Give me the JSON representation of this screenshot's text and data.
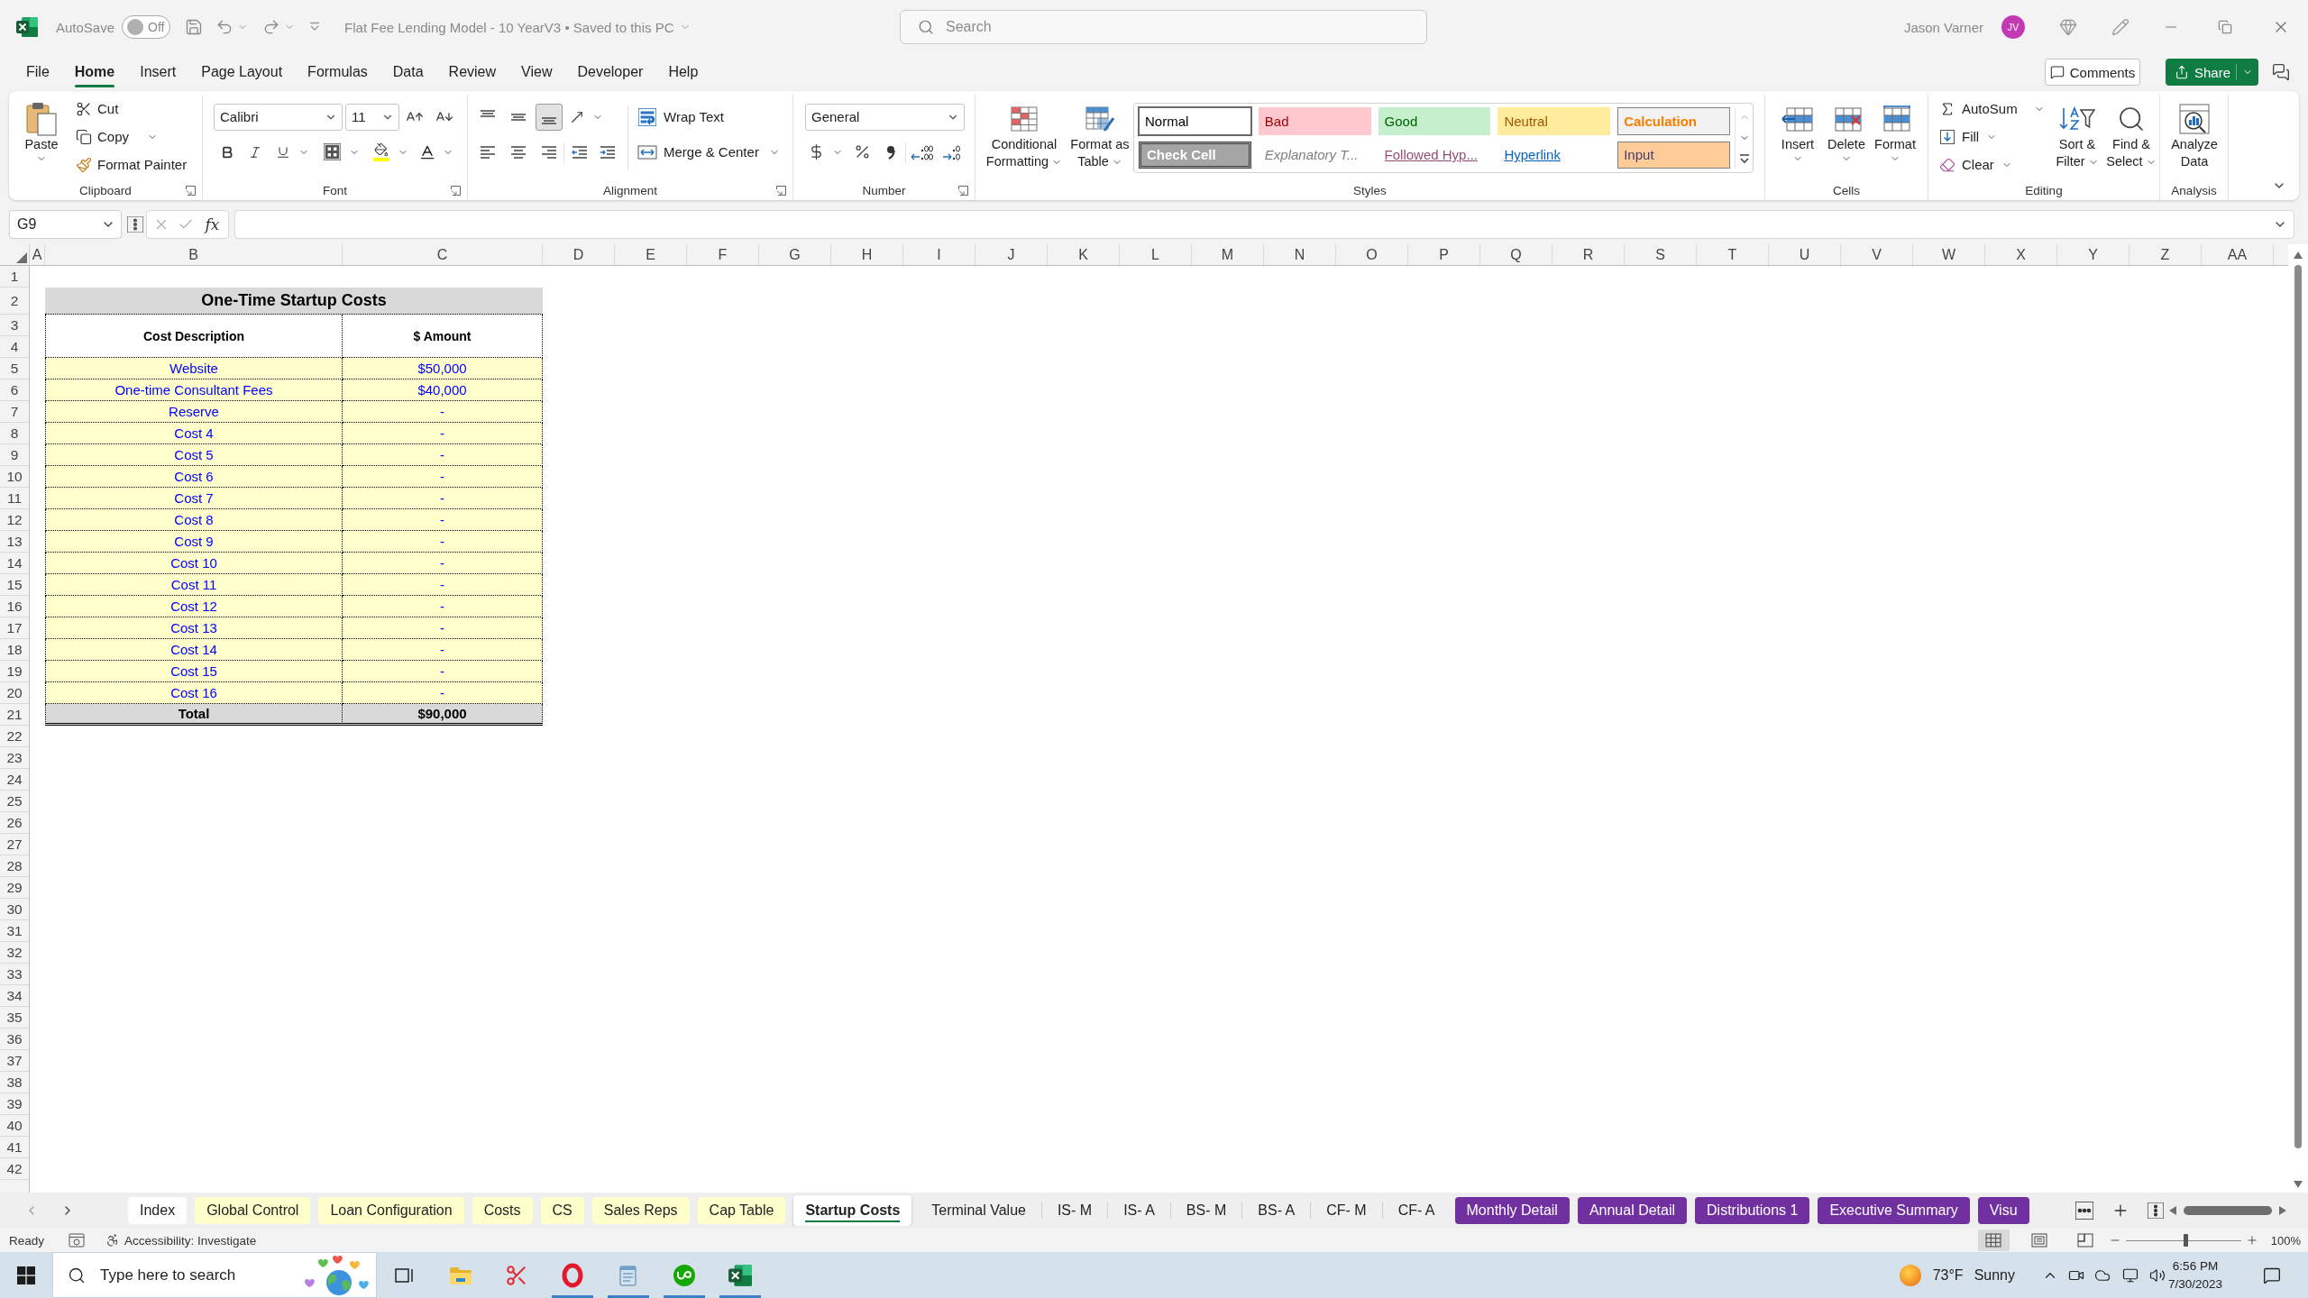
{
  "title_bar": {
    "autosave_label": "AutoSave",
    "autosave": {
      "on": false,
      "label": "Off"
    },
    "document_title": "Flat Fee Lending Model - 10 YearV3 • Saved to this PC",
    "search_placeholder": "Search",
    "user_name": "Jason Varner",
    "user_initials": "JV"
  },
  "menu_tabs": [
    {
      "label": "File",
      "selected": false
    },
    {
      "label": "Home",
      "selected": true
    },
    {
      "label": "Insert",
      "selected": false
    },
    {
      "label": "Page Layout",
      "selected": false
    },
    {
      "label": "Formulas",
      "selected": false
    },
    {
      "label": "Data",
      "selected": false
    },
    {
      "label": "Review",
      "selected": false
    },
    {
      "label": "View",
      "selected": false
    },
    {
      "label": "Developer",
      "selected": false
    },
    {
      "label": "Help",
      "selected": false
    }
  ],
  "header_buttons": {
    "comments": "Comments",
    "share": "Share"
  },
  "ribbon": {
    "clipboard": {
      "label": "Clipboard",
      "paste": "Paste",
      "cut": "Cut",
      "copy": "Copy",
      "format_painter": "Format Painter"
    },
    "font": {
      "label": "Font",
      "family": "Calibri",
      "size": "11"
    },
    "alignment": {
      "label": "Alignment",
      "vertical_align": [
        {
          "kind": "top",
          "selected": false
        },
        {
          "kind": "middle",
          "selected": false
        },
        {
          "kind": "bottom",
          "selected": true
        }
      ],
      "wrap_text": "Wrap Text",
      "merge_center": "Merge & Center"
    },
    "number": {
      "label": "Number",
      "format": "General"
    },
    "styles": {
      "label": "Styles",
      "conditional_formatting": "Conditional Formatting",
      "format_as_table": "Format as Table",
      "gallery": [
        {
          "label": "Normal",
          "kind": "normal",
          "selected": true
        },
        {
          "label": "Bad",
          "kind": "bad",
          "selected": false
        },
        {
          "label": "Good",
          "kind": "good",
          "selected": false
        },
        {
          "label": "Neutral",
          "kind": "neutral",
          "selected": false
        },
        {
          "label": "Calculation",
          "kind": "calculation",
          "selected": false
        },
        {
          "label": "Check Cell",
          "kind": "check",
          "selected": false
        },
        {
          "label": "Explanatory T...",
          "kind": "explanatory",
          "selected": false
        },
        {
          "label": "Followed Hyp...",
          "kind": "followed",
          "selected": false
        },
        {
          "label": "Hyperlink",
          "kind": "hyperlink",
          "selected": false
        },
        {
          "label": "Input",
          "kind": "input",
          "selected": false
        }
      ]
    },
    "cells": {
      "label": "Cells",
      "buttons": [
        {
          "kind": "insert",
          "label": "Insert"
        },
        {
          "kind": "delete",
          "label": "Delete"
        },
        {
          "kind": "format",
          "label": "Format"
        }
      ]
    },
    "editing": {
      "label": "Editing",
      "autosum": "AutoSum",
      "fill": "Fill",
      "clear": "Clear",
      "sort_filter": "Sort & Filter",
      "find_select": "Find & Select"
    },
    "analysis": {
      "label": "Analysis",
      "analyze_data": "Analyze Data"
    }
  },
  "formula_bar": {
    "name_box": "G9",
    "function_label": "fx"
  },
  "columns": [
    "A",
    "B",
    "C",
    "D",
    "E",
    "F",
    "G",
    "H",
    "I",
    "J",
    "K",
    "L",
    "M",
    "N",
    "O",
    "P",
    "Q",
    "R",
    "S",
    "T",
    "U",
    "V",
    "W",
    "X",
    "Y",
    "Z",
    "AA"
  ],
  "rows": [
    "1",
    "2",
    "3",
    "4",
    "5",
    "6",
    "7",
    "8",
    "9",
    "10",
    "11",
    "12",
    "13",
    "14",
    "15",
    "16",
    "17",
    "18",
    "19",
    "20",
    "21",
    "22",
    "23",
    "24",
    "25",
    "26",
    "27",
    "28",
    "29",
    "30",
    "31",
    "32",
    "33",
    "34",
    "35",
    "36",
    "37",
    "38",
    "39",
    "40",
    "41",
    "42"
  ],
  "sheet": {
    "title": "One-Time Startup Costs",
    "headers": [
      "Cost Description",
      "$ Amount"
    ],
    "items": [
      {
        "description": "Website",
        "amount": "$50,000"
      },
      {
        "description": "One-time Consultant Fees",
        "amount": "$40,000"
      },
      {
        "description": "Reserve",
        "amount": "-"
      },
      {
        "description": "Cost 4",
        "amount": "-"
      },
      {
        "description": "Cost 5",
        "amount": "-"
      },
      {
        "description": "Cost 6",
        "amount": "-"
      },
      {
        "description": "Cost 7",
        "amount": "-"
      },
      {
        "description": "Cost 8",
        "amount": "-"
      },
      {
        "description": "Cost 9",
        "amount": "-"
      },
      {
        "description": "Cost 10",
        "amount": "-"
      },
      {
        "description": "Cost 11",
        "amount": "-"
      },
      {
        "description": "Cost 12",
        "amount": "-"
      },
      {
        "description": "Cost 13",
        "amount": "-"
      },
      {
        "description": "Cost 14",
        "amount": "-"
      },
      {
        "description": "Cost 15",
        "amount": "-"
      },
      {
        "description": "Cost 16",
        "amount": "-"
      }
    ],
    "total": {
      "label": "Total",
      "amount": "$90,000"
    }
  },
  "sheet_tabs": [
    {
      "label": "Index",
      "color": "#ffffff",
      "selected": false
    },
    {
      "label": "Global Control",
      "color": "#ffffcc",
      "selected": false
    },
    {
      "label": "Loan Configuration",
      "color": "#ffffcc",
      "selected": false
    },
    {
      "label": "Costs",
      "color": "#ffffcc",
      "selected": false
    },
    {
      "label": "CS",
      "color": "#ffffcc",
      "selected": false
    },
    {
      "label": "Sales Reps",
      "color": "#ffffcc",
      "selected": false
    },
    {
      "label": "Cap Table",
      "color": "#ffffcc",
      "selected": false
    },
    {
      "label": "Startup Costs",
      "selected": true
    },
    {
      "label": "Terminal Value",
      "selected": false
    },
    {
      "label": "IS- M",
      "selected": false
    },
    {
      "label": "IS- A",
      "selected": false
    },
    {
      "label": "BS- M",
      "selected": false
    },
    {
      "label": "BS- A",
      "selected": false
    },
    {
      "label": "CF- M",
      "selected": false
    },
    {
      "label": "CF- A",
      "selected": false
    },
    {
      "label": "Monthly Detail",
      "color": "#7030a0",
      "selected": false
    },
    {
      "label": "Annual Detail",
      "color": "#7030a0",
      "selected": false
    },
    {
      "label": "Distributions 1",
      "color": "#7030a0",
      "selected": false
    },
    {
      "label": "Executive Summary",
      "color": "#7030a0",
      "selected": false
    },
    {
      "label": "Visu",
      "color": "#7030a0",
      "selected": false
    }
  ],
  "status_bar": {
    "ready": "Ready",
    "accessibility": "Accessibility: Investigate",
    "views": [
      {
        "kind": "normal",
        "selected": true
      },
      {
        "kind": "page_layout",
        "selected": false
      },
      {
        "kind": "page_break",
        "selected": false
      }
    ],
    "zoom_slider": {
      "level": 0.52
    },
    "zoom": "100%"
  },
  "taskbar": {
    "search_placeholder": "Type here to search",
    "apps": [
      {
        "kind": "task_view",
        "running": false
      },
      {
        "kind": "folder",
        "running": false
      },
      {
        "kind": "scissors",
        "running": false
      },
      {
        "kind": "ring",
        "running": true
      },
      {
        "kind": "notepad",
        "running": true
      },
      {
        "kind": "badge",
        "running": true
      },
      {
        "kind": "spreadsheet",
        "running": true
      }
    ],
    "weather": {
      "temperature": "73°F",
      "condition": "Sunny"
    },
    "time": "6:56 PM",
    "date": "7/30/2023"
  }
}
